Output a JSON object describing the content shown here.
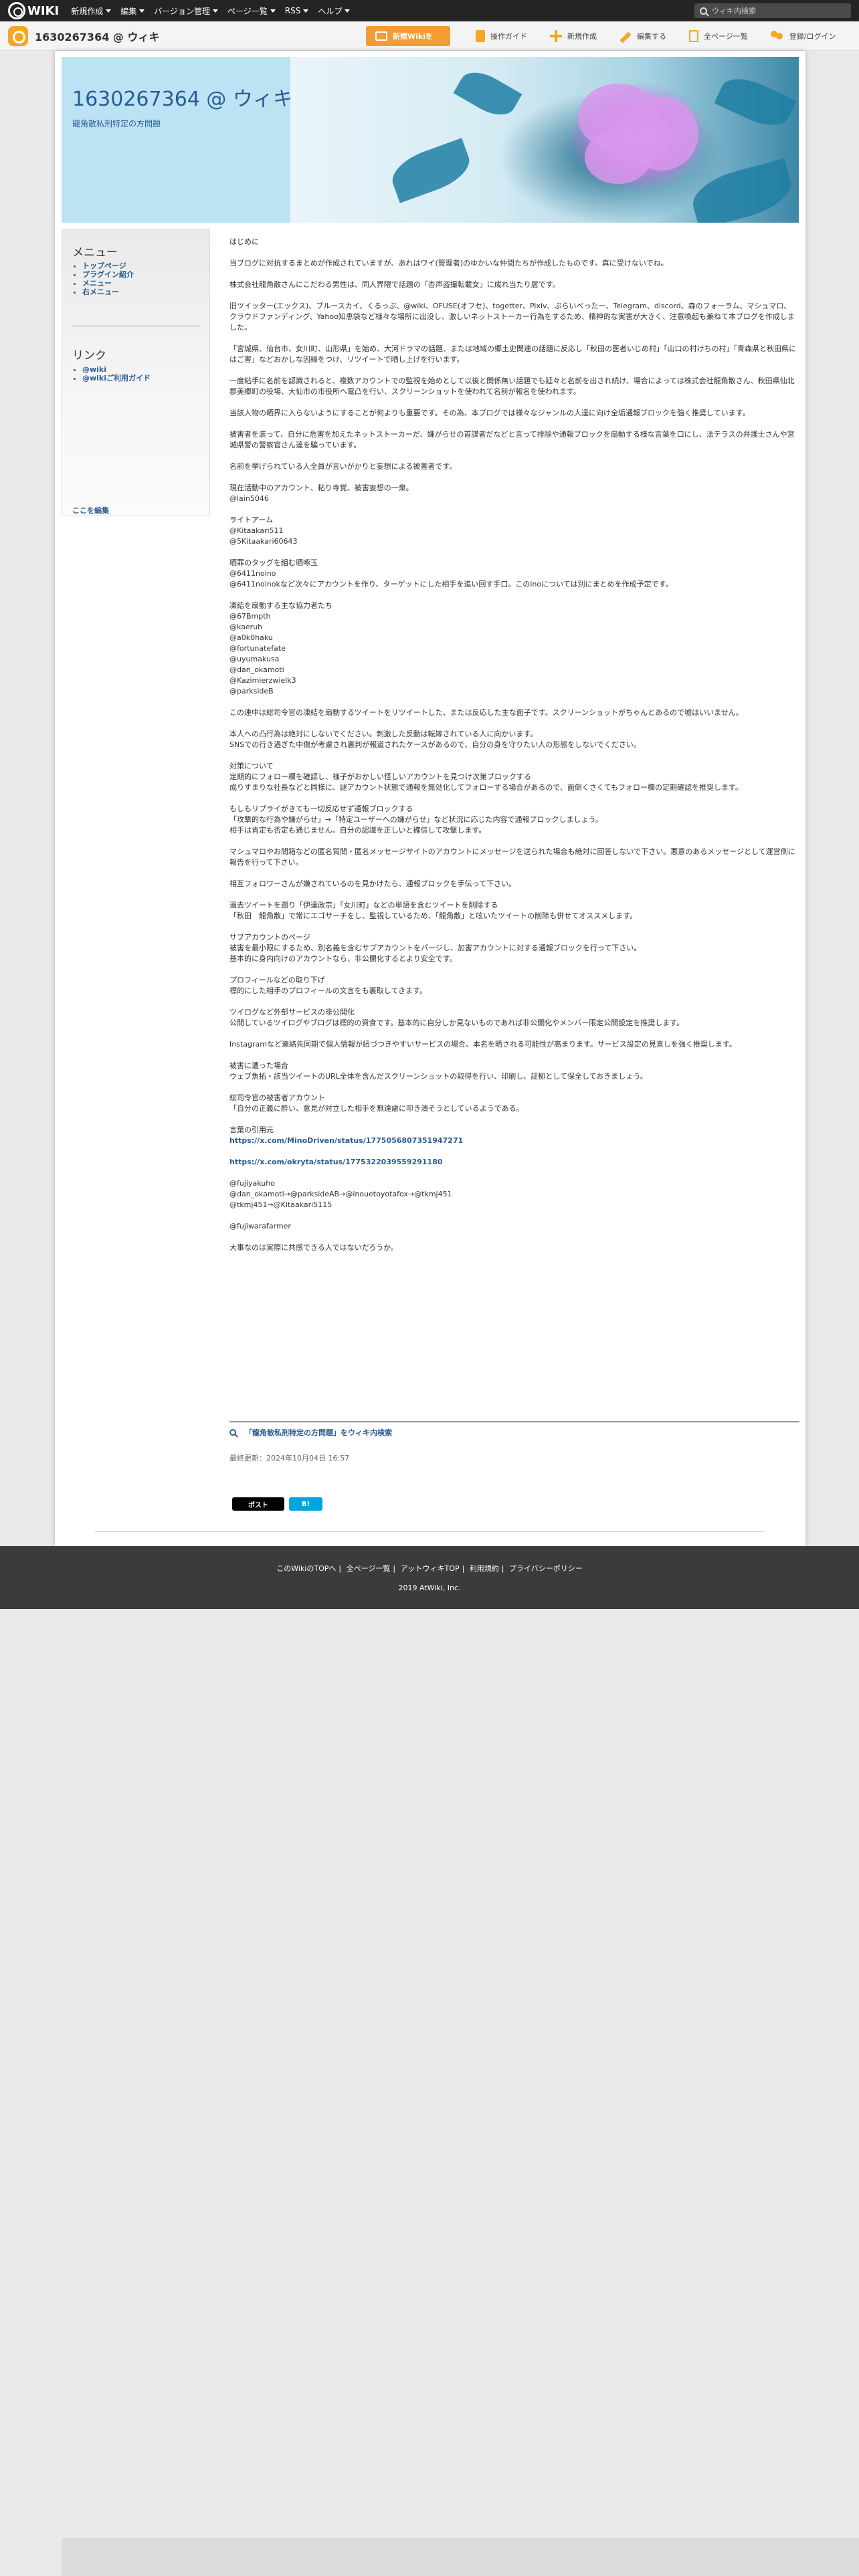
{
  "topbar": {
    "logo": "WIKI",
    "nav": [
      "新規作成",
      "編集",
      "バージョン管理",
      "ページ一覧",
      "RSS",
      "ヘルプ"
    ],
    "search_placeholder": "ウィキ内検索"
  },
  "subbar": {
    "wiki_title": "1630267364 @ ウィキ",
    "buttons": {
      "register": "新規Wikiを",
      "guide": "操作ガイド",
      "create": "新規作成",
      "edit": "編集する",
      "all_pages": "全ページ一覧",
      "login": "登録/ログイン"
    }
  },
  "header": {
    "title": "1630267364 @ ウィキ",
    "subtitle": "龍角散私刑特定の方問題"
  },
  "sidebar": {
    "menu_heading": "メニュー",
    "menu_items": [
      "トップページ",
      "プラグイン紹介",
      "メニュー",
      "右メニュー"
    ],
    "links_heading": "リンク",
    "link_items": [
      "@wiki",
      "@wikiご利用ガイド"
    ],
    "edit_link": "ここを編集"
  },
  "content": {
    "paragraphs": [
      "はじめに",
      "当ブログに対抗するまとめが作成されていますが、あれはワイ(管理者)のゆかいな仲間たちが作成したものです。真に受けないでね。",
      "株式会社龍角散さんにこだわる男性は、同人界隈で話題の「杏声盗撮転載女」に成れ当たり居です。",
      "旧ツイッター(エックス)、ブルースカイ、くるっぷ、@wiki、OFUSE(オフセ)、togetter、Pixiv、ぷらいべったー、Telegram、discord、森のフォーラム、マシュマロ、クラウドファンディング、Yahoo知恵袋など様々な場所に出没し、激しいネットストーカー行為をするため、精神的な実害が大きく、注意喚起も兼ねて本ブログを作成しました。",
      "「宮城県、仙台市、女川町、山形県」を始め、大河ドラマの話題、または地域の郷土史関連の話題に反応し「秋田の医者いじめ村」「山口の村けちの村」「青森県と秋田県にはご害」などおかしな因縁をつけ、リツイートで晒し上げを行います。",
      "一度粘手に名前を認識されると、複数アカウントでの監視を始めとして以後と関係無い話題でも延々と名前を出され続け、場合によっては株式会社龍角散さん、秋田県仙北郡美郷町の役場、大仙市の市役所へ電凸を行い、スクリーンショットを使われて名前が報名を使われます。",
      "当該人物の晒界に入らないようにすることが何よりも重要です。その為、本ブログでは様々なジャンルの人達に向け全垢通報ブロックを強く推奨しています。",
      "被害者を装って、自分に危害を加えたネットストーカーだ、嫌がらせの首謀者だなどと言って排除や通報ブロックを扇動する様な言葉を口にし、法テラスの弁護士さんや宮城県警の警察官さん達を騙っています。",
      "名前を挙げられている人全員が言いがかりと妄想による被害者です。",
      "現在活動中のアカウント、粘り寺覚、被害妄想の一衆。\n@lain5046",
      "ライトアーム\n@Kitaakari511\n@5Kitaakari60643",
      "晒罪のタッグを組む晒啄玉\n@6411noino\n@6411noinokなど次々にアカウントを作り、ターゲットにした相手を追い回す手口。このinoについては別にまとめを作成予定です。",
      "凍結を扇動する主な協力者たち\n@67Bmpth\n@kaeruh\n@a0k0haku\n@fortunatefate\n@uyumakusa\n@dan_okamoti\n@Kazimierzwielk3\n@parksideB",
      "この連中は総司令官の凍結を扇動するツイートをリツイートした、または反応した主な面子です。スクリーンショットがちゃんとあるので嘘はいいません。",
      "本人への凸行為は絶対にしないでください。刺激した反動は転嫁されている人に向かいます。\nSNSでの行き過ぎた中傷が考慮され裏判が報道されたケースがあるので、自分の身を守りたい人の形態をしないでください。",
      "対策について\n定期的にフォロー欄を確認し、様子がおかしい怪しいアカウントを見つけ次第ブロックする\n成りすまりな社長などと同様に、謎アカウント状態で通報を無効化してフォローする場合があるので、面倒くさくてもフォロー欄の定期確認を推奨します。",
      "もしもリプライがきても一切反応せず通報ブロックする\n「攻撃的な行為や嫌がらせ」→「特定ユーザーへの嫌がらせ」など状況に応じた内容で通報ブロックしましょう。\n相手は肯定も否定も通じません。自分の認識を正しいと確信して攻撃します。",
      "マシュマロやお問箱などの匿名質問・匿名メッセージサイトのアカウントにメッセージを送られた場合も絶対に回答しないで下さい。悪意のあるメッセージとして運営側に報告を行って下さい。",
      "相互フォロワーさんが嫌されているのを見かけたら、通報ブロックを手伝って下さい。",
      "過去ツイートを遡り「伊達政宗」「女川町」などの単語を含むツイートを削除する\n「秋田　龍角散」で常にエゴサーチをし、監視しているため、「龍角散」と呟いたツイートの削除も併せてオススメします。",
      "サブアカウントのページ\n被害を最小限にするため、別名義を含むサブアカウントをパージし、加害アカウントに対する通報ブロックを行って下さい。\n基本的に身内向けのアカウントなら、非公開化するとより安全です。",
      "プロフィールなどの取り下げ\n標的にした相手のプロフィールの文言をも裏取してきます。",
      "ツイログなど外部サービスの非公開化\n公開しているツイログやブログは標的の資食です。基本的に自分しか見ないものであれば非公開化やメンバー限定公開設定を推奨します。",
      "Instagramなど連絡先同期で個人情報が紐づつきやすいサービスの場合、本名を晒される可能性が高まります。サービス設定の見直しを強く推奨します。",
      "被害に遭った場合\nウェブ魚拓・該当ツイートのURL全体を含んだスクリーンショットの取得を行い、印刷し、証拠として保全しておきましょう。",
      "総司令官の被害者アカウント\n「自分の正義に酔い、意見が対立した相手を無遠慮に叩き潰そうとしているようである。",
      "言葉の引用元\nhttps://x.com/MinoDriven/status/1775056807351947271",
      "https://x.com/okryta/status/1775322039559291180",
      "@fujiyakuho\n@dan_okamoti→@parksideAB→@inouetoyotafox→@tkmj451\n@tkmj451→@Kitaakari5115",
      "@fujiwarafarmer",
      "大事なのは実際に共感できる人ではないだろうか。"
    ],
    "search_link": "「龍角散私刑特定の方問題」をウィキ内検索",
    "updated": "最終更新：2024年10月04日 16:57",
    "post_button": "ポスト",
    "hatena_button": "B!"
  },
  "footer": {
    "links": [
      "このWikiのTOPへ",
      "全ページ一覧",
      "アットウィキTOP",
      "利用規約",
      "プライバシーポリシー"
    ],
    "copyright": "2019 AtWiki, Inc."
  }
}
